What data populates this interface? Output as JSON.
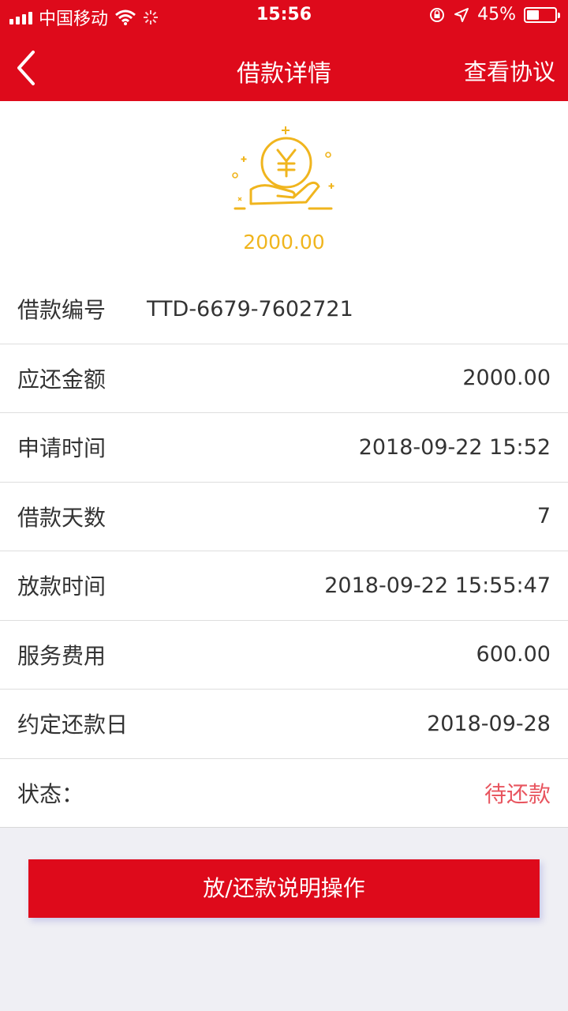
{
  "status_bar": {
    "carrier": "中国移动",
    "time": "15:56",
    "battery_percent": "45%",
    "battery_level": 0.45
  },
  "navbar": {
    "title": "借款详情",
    "right_action": "查看协议",
    "back_icon": "chevron-left-icon"
  },
  "hero": {
    "icon": "coin-hand-icon",
    "amount": "2000.00",
    "accent_color": "#f0b51e"
  },
  "details": {
    "rows": [
      {
        "label": "借款编号",
        "value": "TTD-6679-7602721"
      },
      {
        "label": "应还金额",
        "value": "2000.00"
      },
      {
        "label": "申请时间",
        "value": "2018-09-22 15:52"
      },
      {
        "label": "借款天数",
        "value": "7"
      },
      {
        "label": "放款时间",
        "value": "2018-09-22 15:55:47"
      },
      {
        "label": "服务费用",
        "value": "600.00"
      },
      {
        "label": "约定还款日",
        "value": "2018-09-28"
      },
      {
        "label": "状态：",
        "value": "待还款"
      }
    ]
  },
  "action": {
    "label": "放/还款说明操作"
  },
  "colors": {
    "brand": "#de0a1b",
    "status": "#e8555f"
  }
}
